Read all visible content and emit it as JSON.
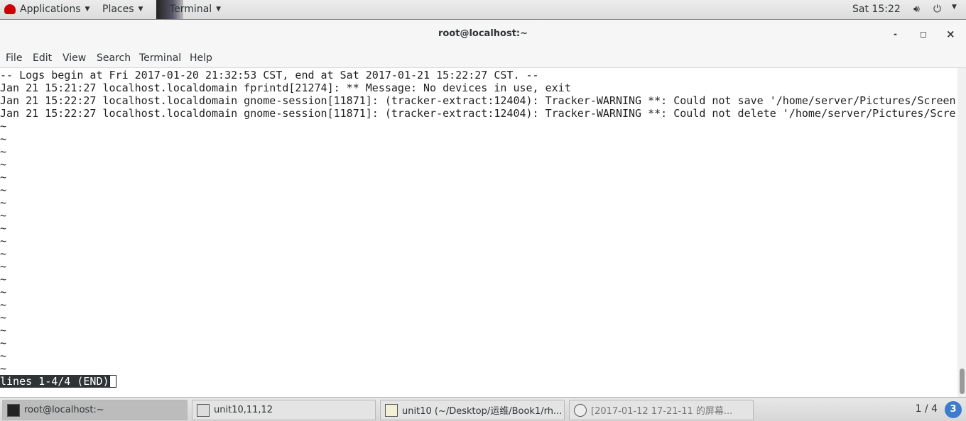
{
  "topbar": {
    "applications": "Applications",
    "places": "Places",
    "terminal": "Terminal",
    "clock": "Sat 15:22",
    "icons": [
      "redhat-logo-icon",
      "volume-icon",
      "power-icon",
      "chevron-down-icon"
    ]
  },
  "window": {
    "title": "root@localhost:~",
    "minimize": "-",
    "maximize": "◻",
    "close": "×"
  },
  "menu": [
    "File",
    "Edit",
    "View",
    "Search",
    "Terminal",
    "Help"
  ],
  "terminal": {
    "lines": [
      "-- Logs begin at Fri 2017-01-20 21:32:53 CST, end at Sat 2017-01-21 15:22:27 CST. --",
      "Jan 21 15:21:27 localhost.localdomain fprintd[21274]: ** Message: No devices in use, exit",
      "Jan 21 15:22:27 localhost.localdomain gnome-session[11871]: (tracker-extract:12404): Tracker-WARNING **: Could not save '/home/server/Pictures/Screen",
      "Jan 21 15:22:27 localhost.localdomain gnome-session[11871]: (tracker-extract:12404): Tracker-WARNING **: Could not delete '/home/server/Pictures/Scre"
    ],
    "tilde": "~",
    "status": "lines 1-4/4 (END)"
  },
  "taskbar": {
    "tasks": [
      "root@localhost:~",
      "unit10,11,12",
      "unit10 (~/Desktop/运维/Book1/rh...",
      "[2017-01-12 17-21-11 的屏幕..."
    ],
    "pager": "1 / 4",
    "workspace": "3"
  }
}
